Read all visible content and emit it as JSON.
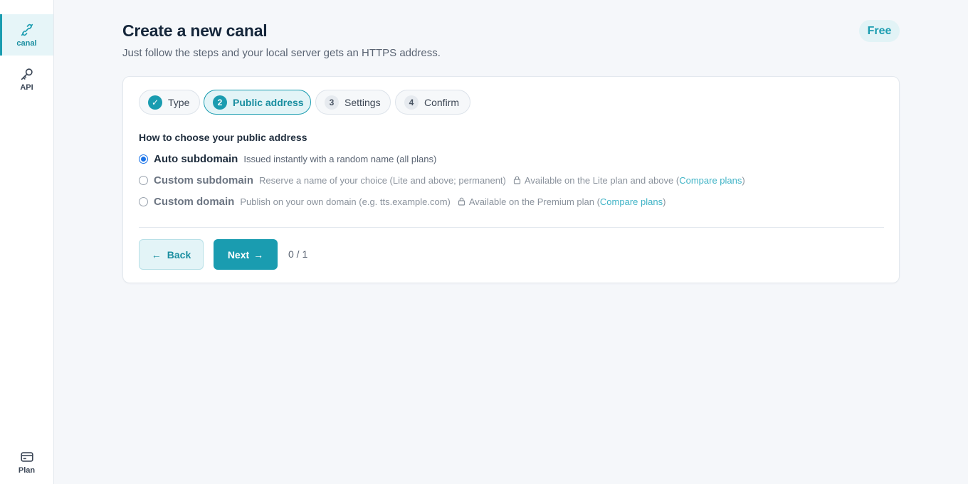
{
  "sidebar": {
    "items": [
      {
        "label": "canal",
        "icon": "link-icon",
        "active": true
      },
      {
        "label": "API",
        "icon": "key-icon",
        "active": false
      }
    ],
    "bottom": {
      "label": "Plan",
      "icon": "card-icon"
    }
  },
  "header": {
    "title": "Create a new canal",
    "subtitle": "Just follow the steps and your local server gets an HTTPS address.",
    "plan_badge": "Free"
  },
  "stepper": {
    "steps": [
      {
        "num": "✓",
        "label": "Type",
        "state": "done"
      },
      {
        "num": "2",
        "label": "Public address",
        "state": "current"
      },
      {
        "num": "3",
        "label": "Settings",
        "state": "upcoming"
      },
      {
        "num": "4",
        "label": "Confirm",
        "state": "upcoming"
      }
    ]
  },
  "section": {
    "label": "How to choose your public address",
    "options": [
      {
        "name": "Auto subdomain",
        "desc": "Issued instantly with a random name (all plans)",
        "selected": true,
        "disabled": false
      },
      {
        "name": "Custom subdomain",
        "desc": "Reserve a name of your choice (Lite and above; permanent)",
        "selected": false,
        "disabled": true,
        "lock_text": "Available on the Lite plan and above (",
        "lock_link": "Compare plans",
        "lock_end": ")"
      },
      {
        "name": "Custom domain",
        "desc": "Publish on your own domain (e.g. tts.example.com)",
        "selected": false,
        "disabled": true,
        "lock_text": "Available on the Premium plan (",
        "lock_link": "Compare plans",
        "lock_end": ")"
      }
    ]
  },
  "footer": {
    "back_arrow": "←",
    "back_label": "Back",
    "next_label": "Next",
    "next_arrow": "→",
    "progress": "0 / 1"
  },
  "colors": {
    "accent": "#1a9cb0",
    "radio": "#1a73e8",
    "link": "#3fb3c6"
  }
}
